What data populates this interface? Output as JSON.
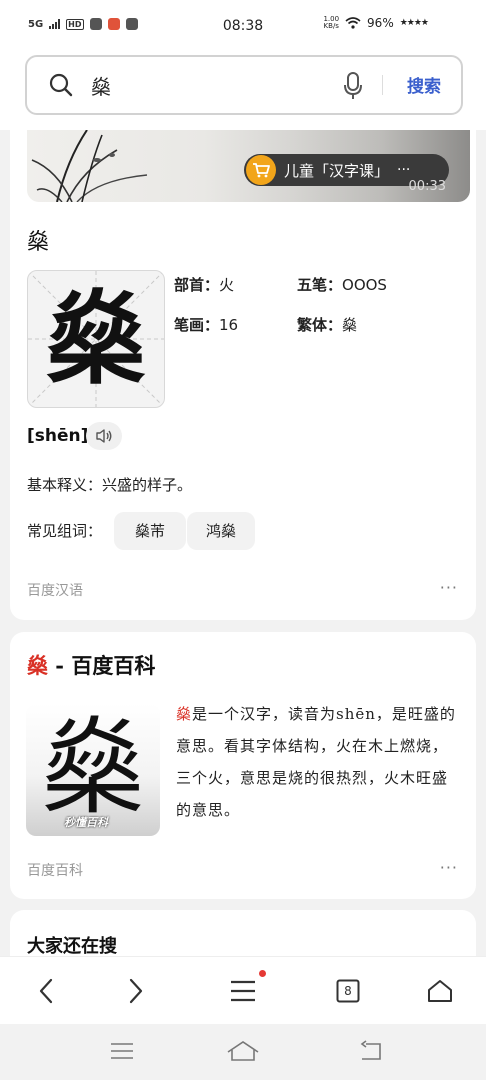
{
  "status_bar": {
    "network": "5G",
    "hd": "HD",
    "time": "08:38",
    "speed_value": "1.00",
    "speed_unit": "KB/s",
    "battery": "96%",
    "stars": "★★★★"
  },
  "search": {
    "query": "燊",
    "button_label": "搜索"
  },
  "banner": {
    "tag_text": "儿童「汉字课」",
    "tag_more": "···",
    "duration": "00:33"
  },
  "dictionary": {
    "character": "燊",
    "radical_label": "部首：",
    "radical_value": "火",
    "wubi_label": "五笔：",
    "wubi_value": "OOOS",
    "strokes_label": "笔画：",
    "strokes_value": "16",
    "traditional_label": "繁体：",
    "traditional_value": "燊",
    "pinyin": "[shēn]",
    "meaning": "基本释义：兴盛的样子。",
    "common_words_label": "常见组词：",
    "common_words": [
      "燊芾",
      "鸿燊"
    ],
    "source": "百度汉语",
    "more": "···"
  },
  "baike": {
    "title_char": "燊",
    "title_rest": " - 百度百科",
    "image_char": "燊",
    "image_logo": "秒懂百科",
    "desc_char": "燊",
    "desc_rest": "是一个汉字，读音为shēn，是旺盛的意思。看其字体结构，火在木上燃烧，三个火，意思是烧的很热烈，火木旺盛的意思。",
    "source": "百度百科",
    "more": "···"
  },
  "related": {
    "title": "大家还在搜"
  },
  "bottom_nav": {
    "tabs_count": "8"
  },
  "colors": {
    "accent_blue": "#3a5fcd",
    "highlight_red": "#d93025",
    "tag_orange": "#f2a51a"
  }
}
